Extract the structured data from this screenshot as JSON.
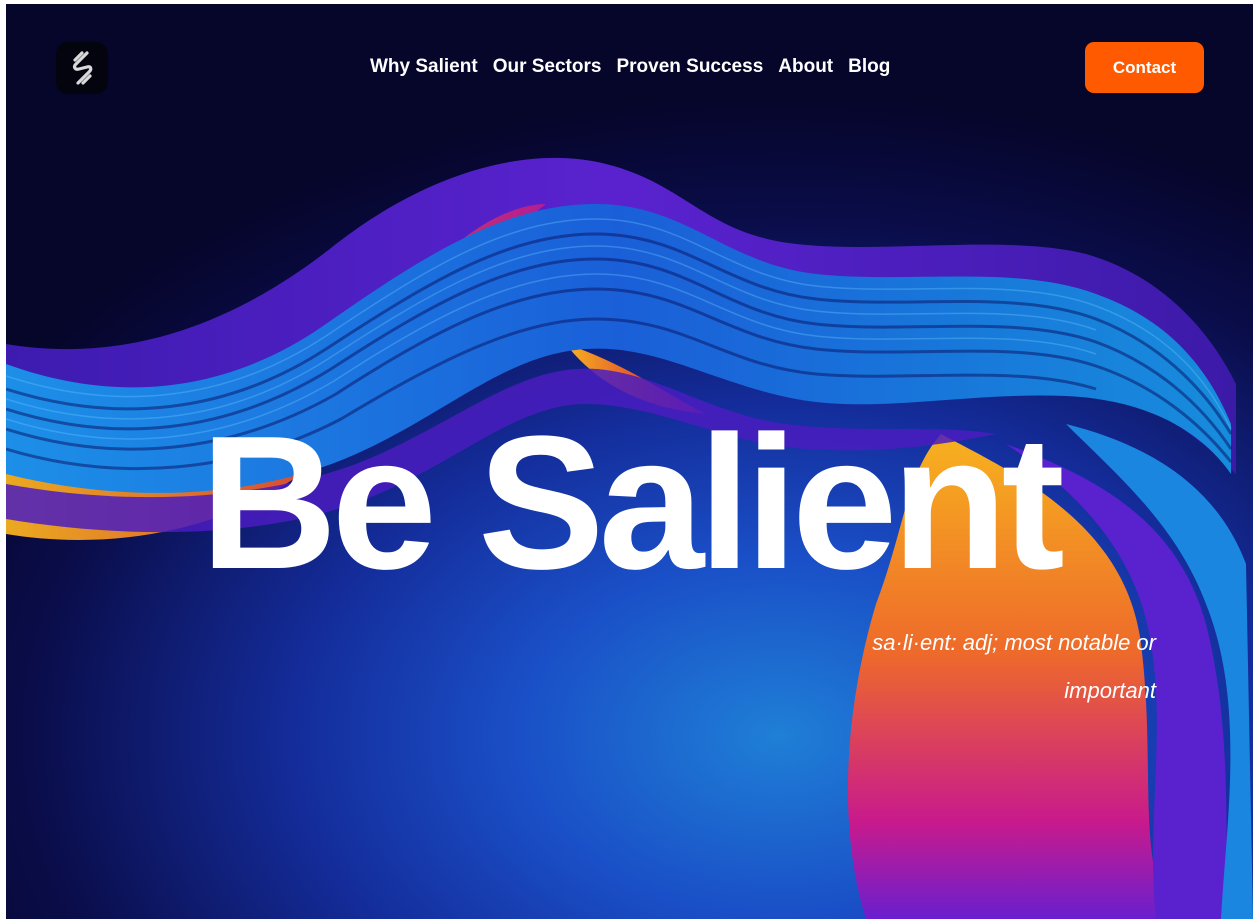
{
  "nav": {
    "logo_icon": "salient-s-logo-icon",
    "links": [
      "Why Salient",
      "Our Sectors",
      "Proven Success",
      "About",
      "Blog"
    ],
    "contact_label": "Contact"
  },
  "hero": {
    "title": "Be Salient",
    "definition": "sa·li·ent: adj; most notable or important"
  },
  "colors": {
    "accent": "#ff5a00",
    "background_dark": "#06052a",
    "background_blue": "#1a4fc7",
    "wave_blue": "#1a86e0",
    "wave_purple": "#5a1fcc",
    "wave_magenta": "#c81a8c",
    "wave_orange": "#f5a21a"
  }
}
